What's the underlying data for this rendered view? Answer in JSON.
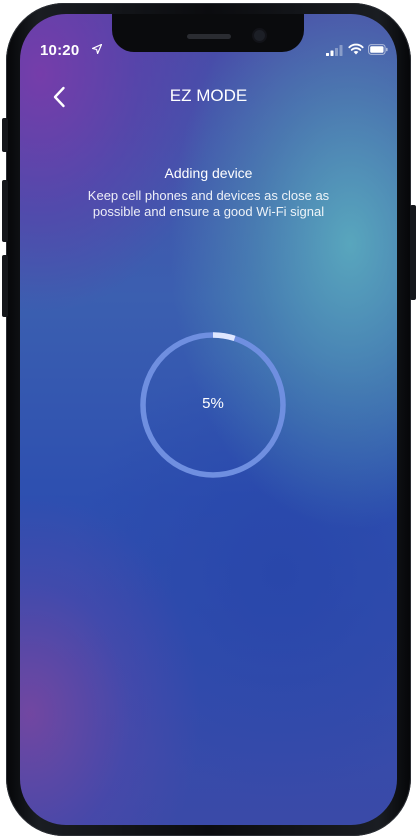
{
  "status_bar": {
    "time": "10:20"
  },
  "nav": {
    "title": "EZ MODE",
    "back_icon": "chevron-left-icon"
  },
  "content": {
    "title": "Adding device",
    "description": "Keep cell phones and devices as close as possible and ensure a good Wi-Fi signal"
  },
  "progress": {
    "value": 0.05,
    "label": "5%"
  },
  "colors": {
    "ring_track": "#6f8fe0",
    "ring_fill": "#dfe7ff",
    "text": "#ffffff"
  }
}
